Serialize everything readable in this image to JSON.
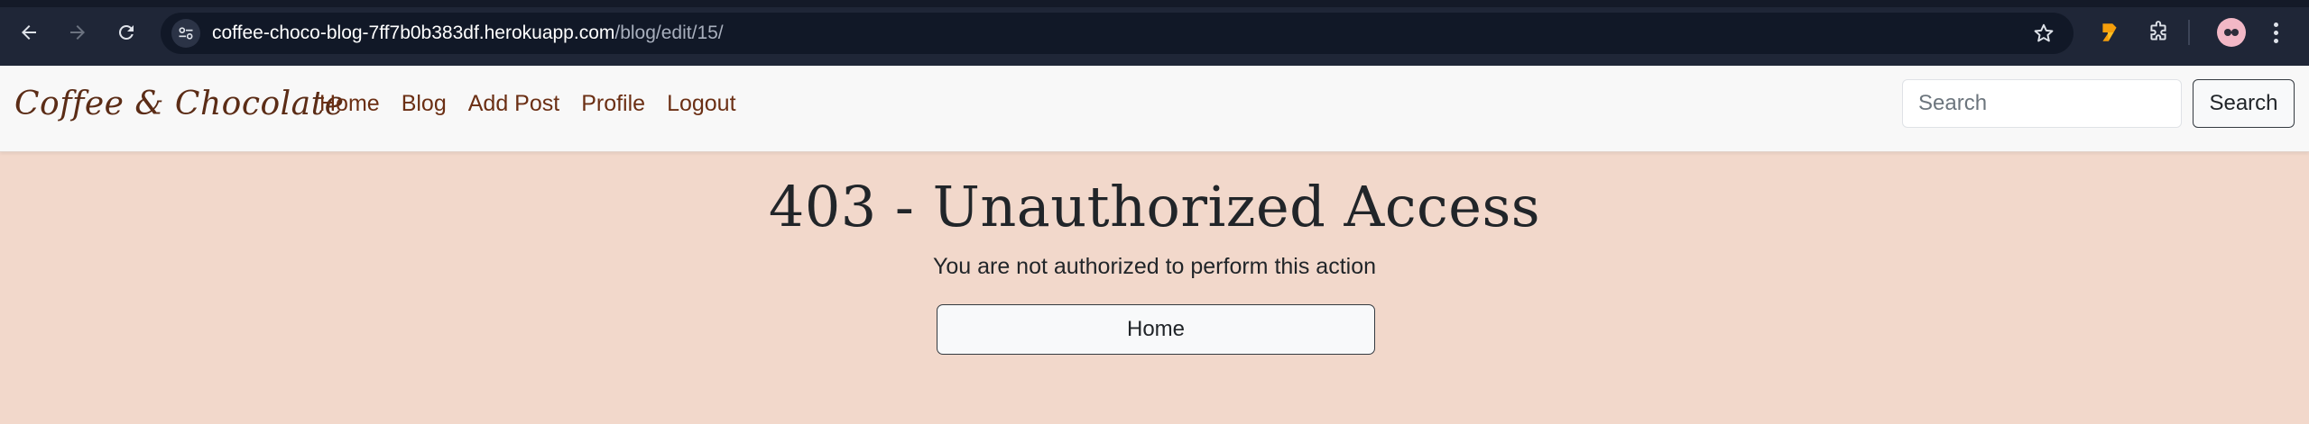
{
  "browser": {
    "url_host": "coffee-choco-blog-7ff7b0b383df.herokuapp.com",
    "url_path": "/blog/edit/15/",
    "icons": [
      "back-icon",
      "forward-icon",
      "reload-icon",
      "site-info-icon",
      "star-icon",
      "extension-icon",
      "puzzle-icon",
      "profile-avatar",
      "more-menu-icon"
    ]
  },
  "navbar": {
    "brand": "Coffee & Chocolate",
    "links": [
      "Home",
      "Blog",
      "Add Post",
      "Profile",
      "Logout"
    ],
    "search_placeholder": "Search",
    "search_button": "Search"
  },
  "main": {
    "title": "403 - Unauthorized Access",
    "message": "You are not authorized to perform this action",
    "home_button": "Home"
  },
  "colors": {
    "page_background": "#f2d8cb",
    "nav_link": "#6b2f14",
    "brand": "#5b2c16",
    "chrome": "#1f2637"
  }
}
